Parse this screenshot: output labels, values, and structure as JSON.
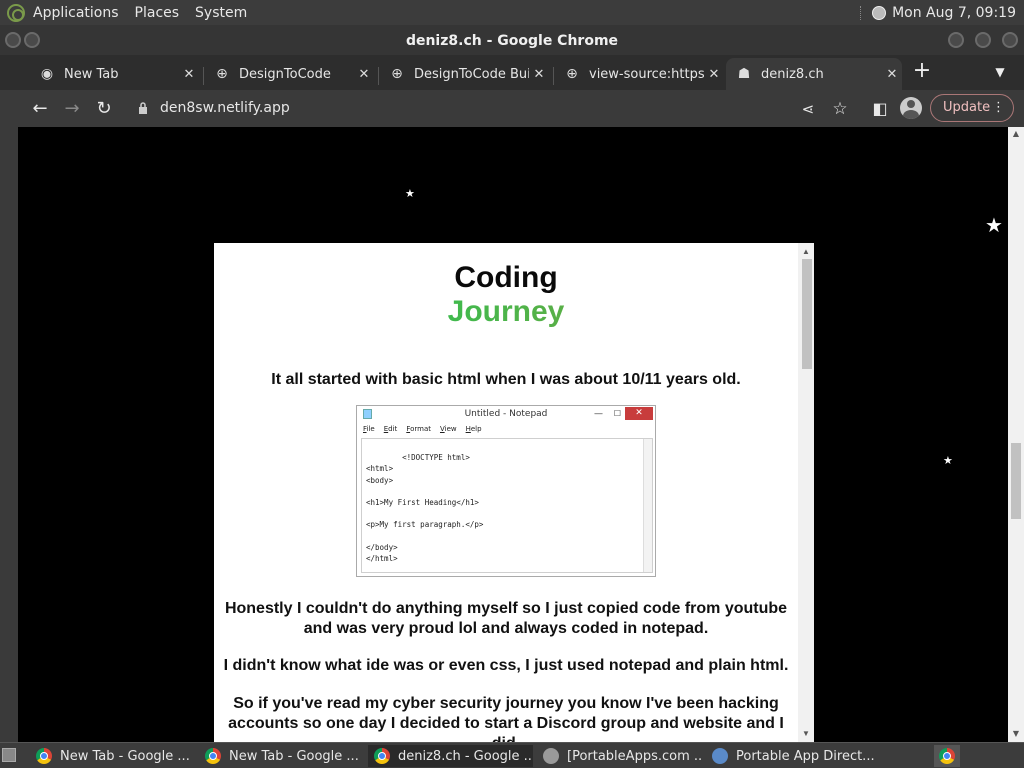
{
  "system_panel": {
    "menus": [
      "Applications",
      "Places",
      "System"
    ],
    "clock": "Mon Aug  7, 09:19"
  },
  "window": {
    "title": "deniz8.ch - Google Chrome"
  },
  "tabs": [
    {
      "label": "New Tab",
      "icon": "chrome-icon",
      "active": false
    },
    {
      "label": "DesignToCode",
      "icon": "globe-icon",
      "active": false
    },
    {
      "label": "DesignToCode Buil",
      "icon": "globe-icon",
      "active": false
    },
    {
      "label": "view-source:https:",
      "icon": "globe-icon",
      "active": false
    },
    {
      "label": "deniz8.ch",
      "icon": "site-icon",
      "active": true
    }
  ],
  "toolbar": {
    "url": "den8sw.netlify.app",
    "update_label": "Update"
  },
  "page": {
    "heading_line1": "Coding",
    "heading_line2": "Journey",
    "para1": "It all started with basic html when I was about 10/11 years old.",
    "para2_line1": "Honestly I couldn't do anything myself so I just copied code from youtube",
    "para2_line2": "and was very proud lol and always coded in notepad.",
    "para3": "I didn't know what ide was or even css, I just used notepad and plain html.",
    "para4_line1": "So if you've read my cyber security journey you know I've been hacking",
    "para4_line2": "accounts so one day I decided to start a Discord group and website and I did.",
    "notepad": {
      "title": "Untitled - Notepad",
      "menu": [
        "File",
        "Edit",
        "Format",
        "View",
        "Help"
      ],
      "code": "<!DOCTYPE html>\n<html>\n<body>\n\n<h1>My First Heading</h1>\n\n<p>My first paragraph.</p>\n\n</body>\n</html>"
    }
  },
  "taskbar": [
    {
      "label": "New Tab - Google ...",
      "icon": "chrome-icon",
      "active": false
    },
    {
      "label": "New Tab - Google ...",
      "icon": "chrome-icon",
      "active": false
    },
    {
      "label": "deniz8.ch - Google ...",
      "icon": "chrome-icon",
      "active": true
    },
    {
      "label": "[PortableApps.com ...",
      "icon": "app-icon",
      "active": false
    },
    {
      "label": "Portable App Direct...",
      "icon": "globe-icon",
      "active": false
    }
  ]
}
